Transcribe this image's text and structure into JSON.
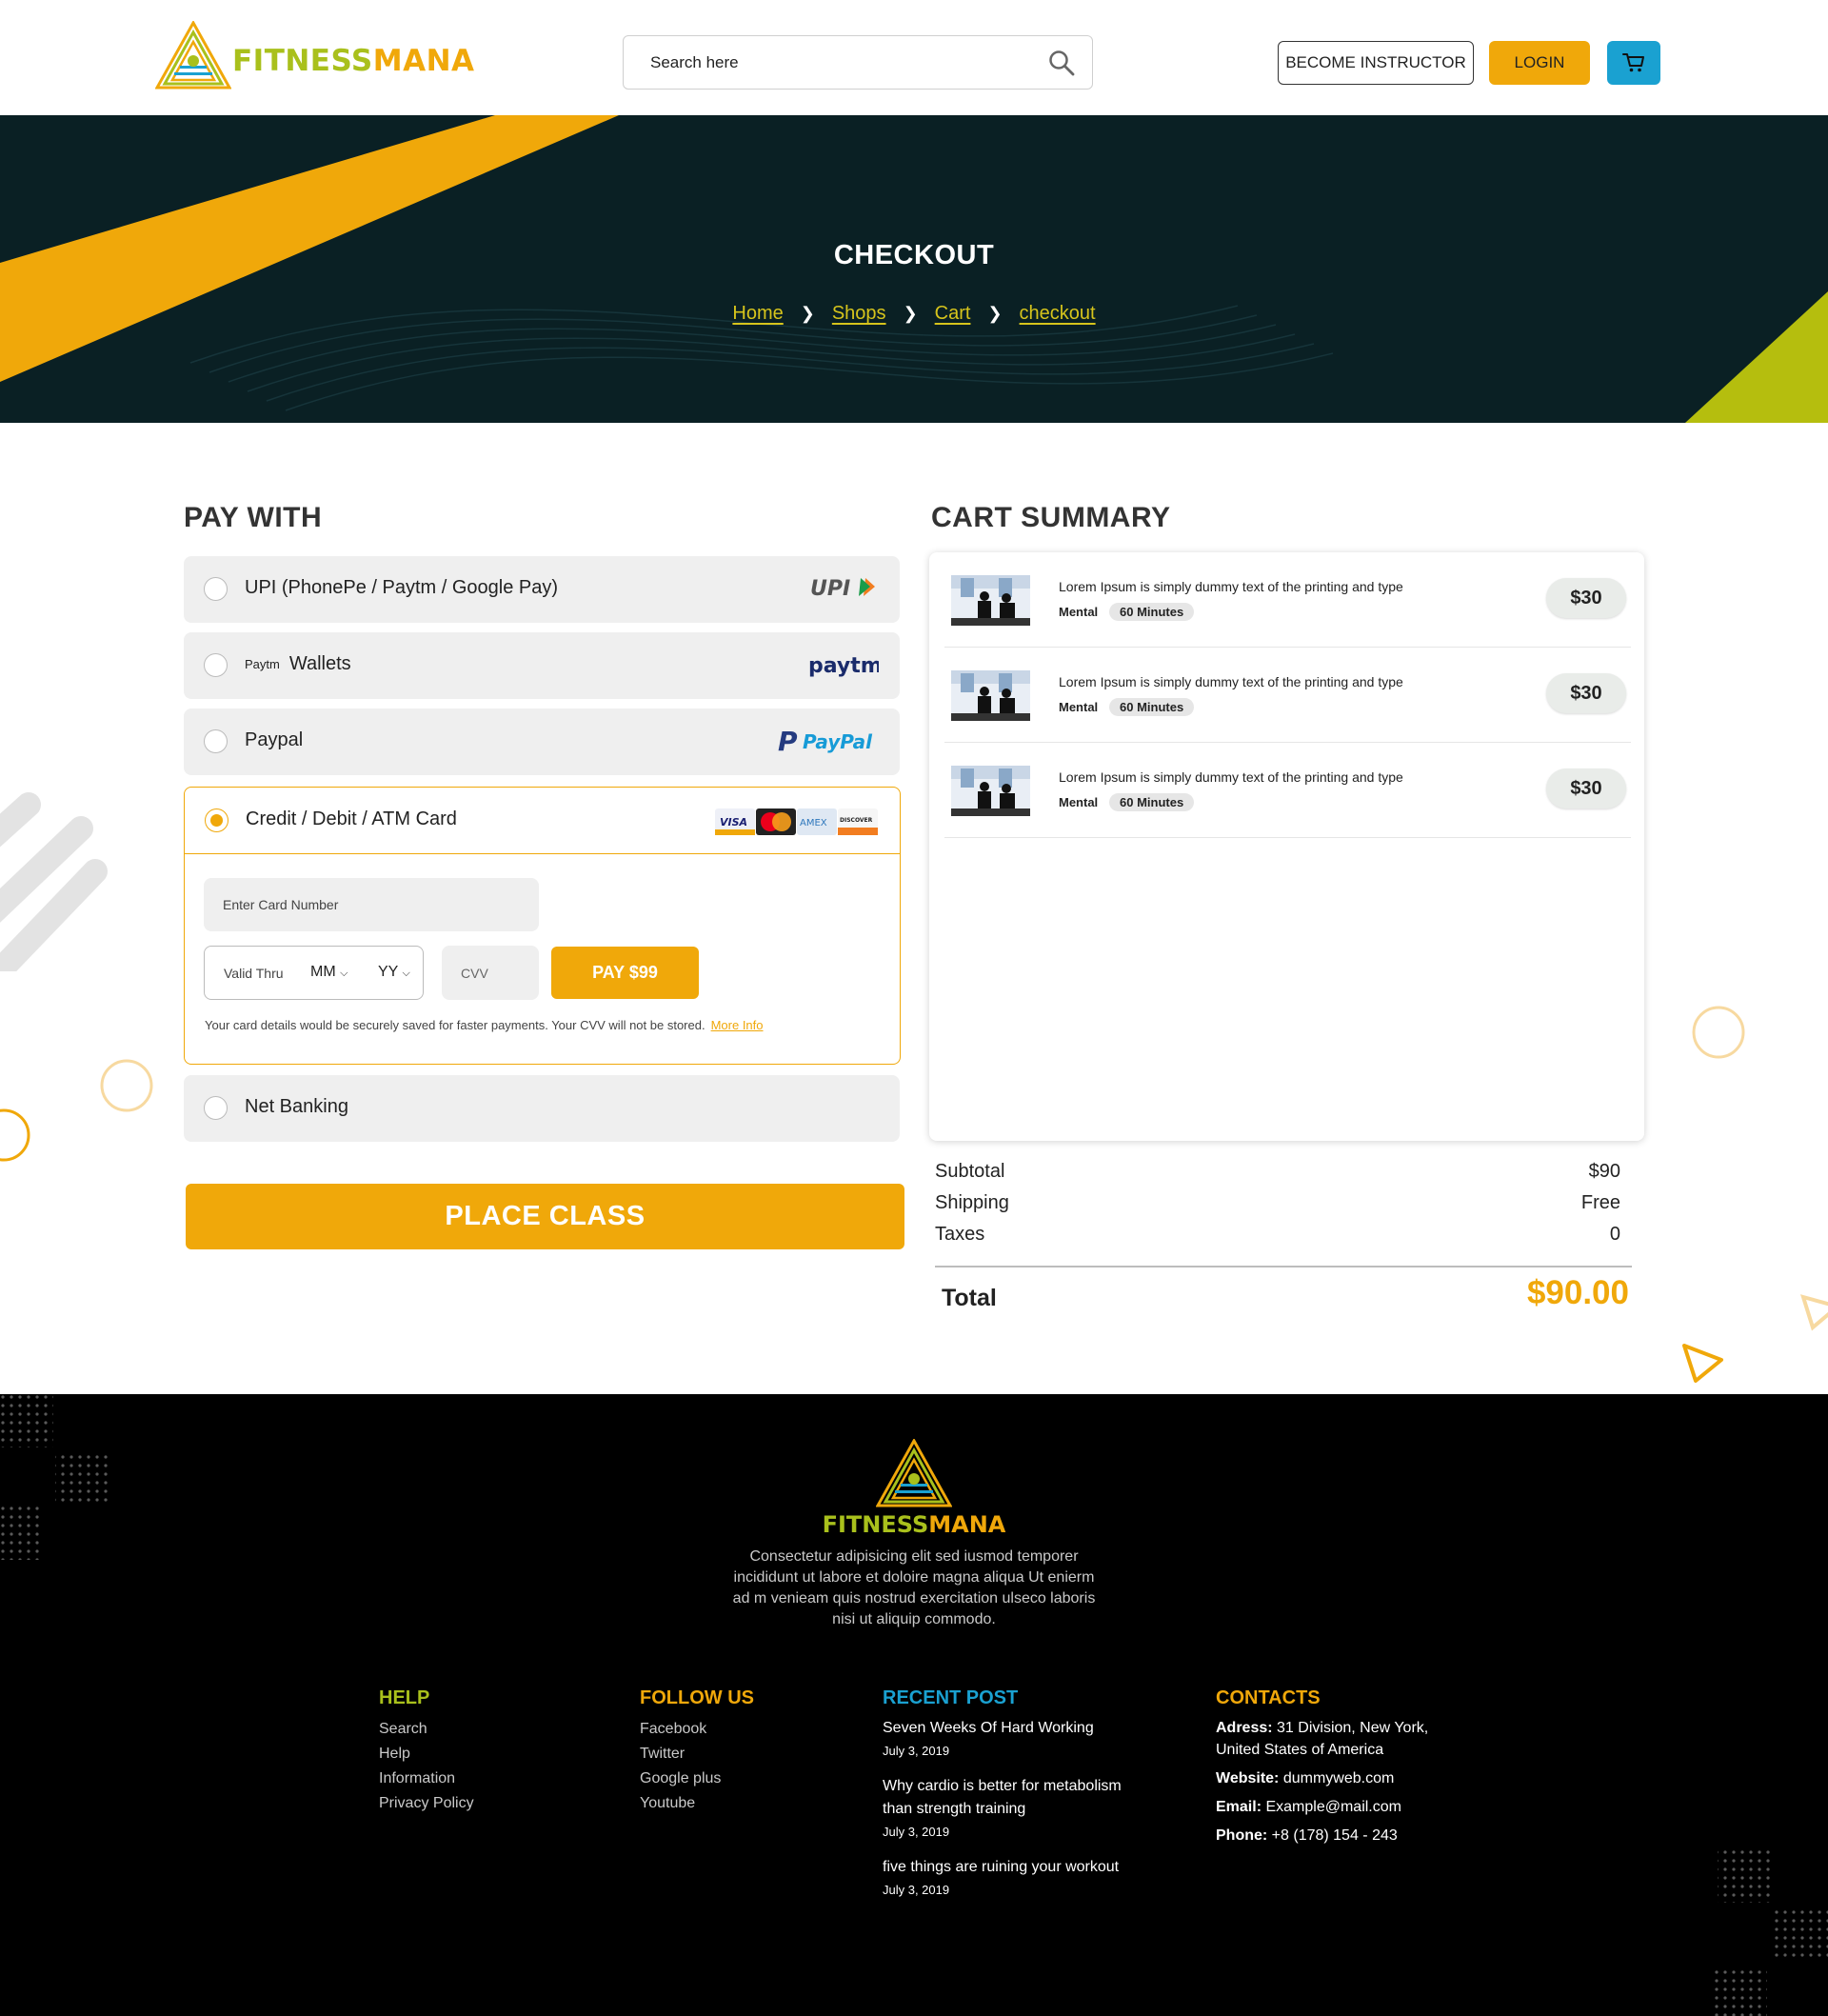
{
  "brand": {
    "name_part1": "FITNESS",
    "name_part2": "MANA"
  },
  "header": {
    "search_placeholder": "Search here",
    "become_instructor": "BECOME INSTRUCTOR",
    "login": "LOGIN",
    "cart_icon": "cart-icon",
    "search_icon": "search-icon"
  },
  "hero": {
    "title": "CHECKOUT",
    "breadcrumbs": [
      "Home",
      "Shops",
      "Cart",
      "checkout"
    ]
  },
  "pay_with": {
    "title": "PAY WITH",
    "options": [
      {
        "label": "UPI (PhonePe / Paytm / Google Pay)",
        "logo": "UPI"
      },
      {
        "prefix": "Paytm",
        "label": "Wallets",
        "logo": "paytm"
      },
      {
        "label": "Paypal",
        "logo": "PayPal"
      },
      {
        "label": "Credit / Debit / ATM Card",
        "selected": true
      },
      {
        "label": "Net Banking"
      }
    ],
    "card": {
      "number_placeholder": "Enter Card Number",
      "valid_thru": "Valid Thru",
      "month": "MM",
      "year": "YY",
      "cvv_placeholder": "CVV",
      "pay_button": "PAY $99",
      "note": "Your card details would be securely saved for faster payments. Your CVV will not be stored.",
      "more_info": "More Info",
      "brands": [
        "VISA",
        "MasterCard",
        "AMEX",
        "DISCOVER"
      ]
    },
    "place_button": "PLACE CLASS"
  },
  "cart": {
    "title": "CART SUMMARY",
    "items": [
      {
        "desc": "Lorem Ipsum is simply dummy text of the printing and type",
        "category": "Mental",
        "duration": "60 Minutes",
        "price": "$30"
      },
      {
        "desc": "Lorem Ipsum is simply dummy text of the printing and type",
        "category": "Mental",
        "duration": "60 Minutes",
        "price": "$30"
      },
      {
        "desc": "Lorem Ipsum is simply dummy text of the printing and type",
        "category": "Mental",
        "duration": "60 Minutes",
        "price": "$30"
      }
    ],
    "subtotal_label": "Subtotal",
    "subtotal": "$90",
    "shipping_label": "Shipping",
    "shipping": "Free",
    "taxes_label": "Taxes",
    "taxes": "0",
    "total_label": "Total",
    "total": "$90.00"
  },
  "footer": {
    "description": "Consectetur adipisicing elit sed iusmod temporer incididunt ut labore et doloire magna aliqua Ut enierm ad m venieam quis nostrud exercitation ulseco laboris nisi ut aliquip commodo.",
    "help": {
      "title": "HELP",
      "links": [
        "Search",
        "Help",
        "Information",
        "Privacy Policy"
      ]
    },
    "follow": {
      "title": "FOLLOW US",
      "links": [
        "Facebook",
        "Twitter",
        "Google plus",
        "Youtube"
      ]
    },
    "recent": {
      "title": "RECENT POST",
      "posts": [
        {
          "title": "Seven Weeks Of Hard Working",
          "date": "July 3, 2019"
        },
        {
          "title": "Why cardio is better for metabolism than strength training",
          "date": "July 3, 2019"
        },
        {
          "title": "five things are ruining your workout",
          "date": "July 3, 2019"
        }
      ]
    },
    "contacts": {
      "title": "CONTACTS",
      "address_label": "Adress:",
      "address": "31 Division, New York, United States of America",
      "website_label": "Website:",
      "website": "dummyweb.com",
      "email_label": "Email:",
      "email": "Example@mail.com",
      "phone_label": "Phone:",
      "phone": "+8 (178) 154 - 243"
    }
  },
  "colors": {
    "accent": "#f0a80a",
    "lime": "#a9c01c",
    "hero_bg": "#0a2024",
    "cart_button": "#1aa1d1"
  }
}
